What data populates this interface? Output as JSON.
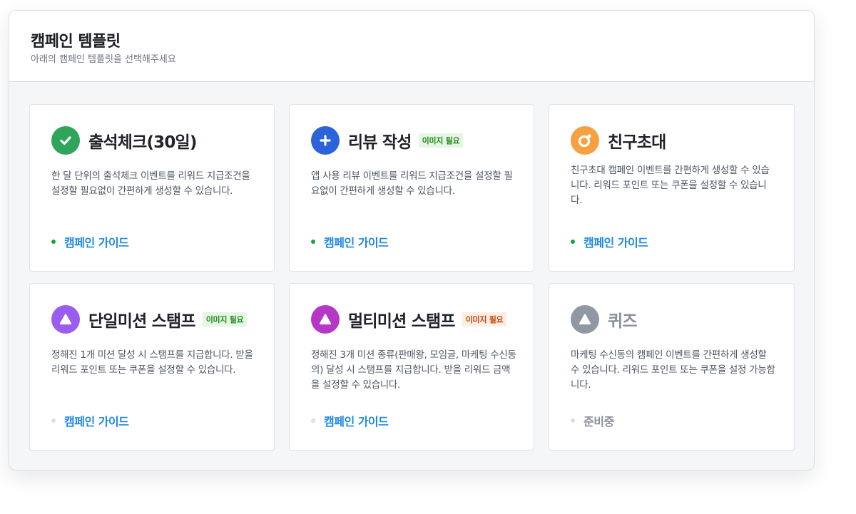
{
  "header": {
    "title": "캠페인 템플릿",
    "subtitle": "아래의 캠페인 템플릿을 선택해주세요"
  },
  "cards": [
    {
      "title": "출석체크(30일)",
      "icon": "check-icon",
      "icon_color": "#2fa45a",
      "badge": "",
      "description": "한 달 단위의 출석체크 이벤트를 리워드 지급조건을 설정할 필요없이 간편하게 생성할 수 있습니다.",
      "link": "캠페인 가이드",
      "status": "active"
    },
    {
      "title": "리뷰 작성",
      "icon": "plus-icon",
      "icon_color": "#2b63d9",
      "badge": "이미지 필요",
      "badge_color": "green",
      "description": "앱 사용 리뷰 이벤트를 리워드 지급조건을 설정할 필요없이 간편하게 생성할 수 있습니다.",
      "link": "캠페인 가이드",
      "status": "active"
    },
    {
      "title": "친구초대",
      "icon": "invite-icon",
      "icon_color": "#f5a142",
      "badge": "",
      "description": "친구초대 캠페인 이벤트를 간편하게 생성할 수 있습니다. 리워드 포인트 또는 쿠폰을 설정할 수 있습니다.",
      "link": "캠페인 가이드",
      "status": "active"
    },
    {
      "title": "단일미션 스탬프",
      "icon": "triangle-icon",
      "icon_color": "#9b5cf0",
      "badge": "이미지 필요",
      "badge_color": "green",
      "description": "정해진 1개 미션 달성 시 스탬프를 지급합니다. 받을 리워드 포인트 또는 쿠폰을 설정할 수 있습니다.",
      "link": "캠페인 가이드",
      "status": "inactive"
    },
    {
      "title": "멀티미션 스탬프",
      "icon": "triangle-icon",
      "icon_color": "#b636c6",
      "badge": "이미지 필요",
      "badge_color": "orange",
      "description": "정해진 3개 미션 종류(판매왕, 모임글, 마케팅 수신동의) 달성 시 스탬프를 지급합니다. 받을 리워드 금액을 설정할 수 있습니다.",
      "link": "캠페인 가이드",
      "status": "inactive"
    },
    {
      "title": "퀴즈",
      "icon": "triangle-icon",
      "icon_color": "#8f98a3",
      "badge": "",
      "description": "마케팅 수신동의 캠페인 이벤트를 간편하게 생성할 수 있습니다. 리워드 포인트 또는 쿠폰을 설정 가능합니다.",
      "link": "준비중",
      "status": "disabled"
    }
  ]
}
